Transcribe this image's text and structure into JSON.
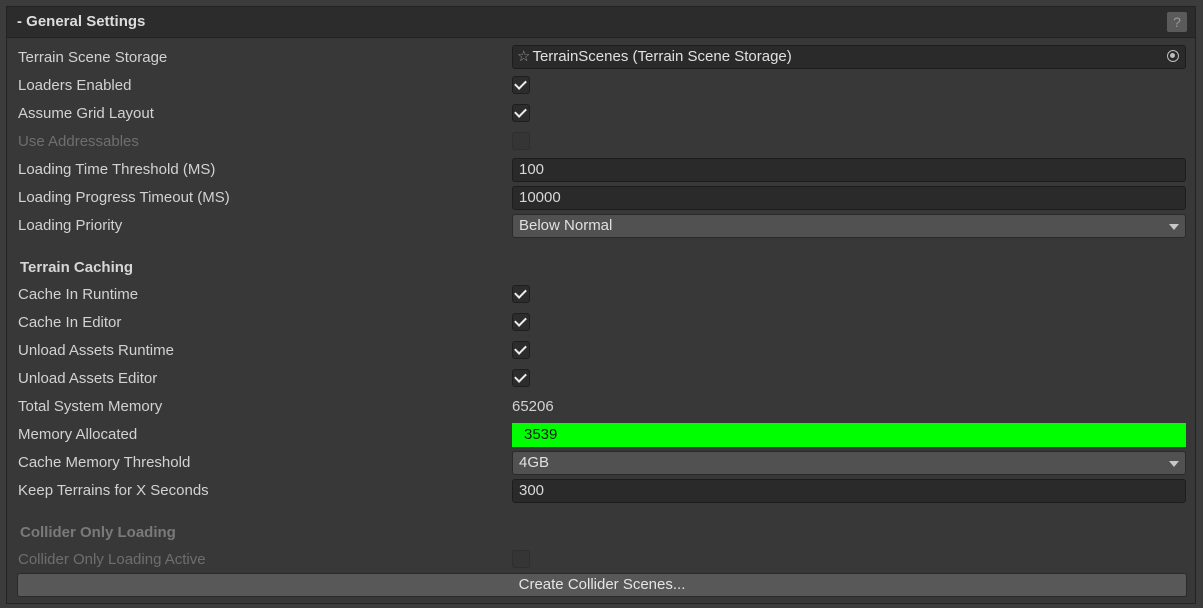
{
  "header": {
    "title": "- General Settings",
    "help_icon": "?"
  },
  "general": {
    "terrain_scene_storage": {
      "label": "Terrain Scene Storage",
      "value": "TerrainScenes (Terrain Scene Storage)"
    },
    "loaders_enabled": {
      "label": "Loaders Enabled",
      "checked": true
    },
    "assume_grid_layout": {
      "label": "Assume Grid Layout",
      "checked": true
    },
    "use_addressables": {
      "label": "Use Addressables",
      "checked": false,
      "disabled": true
    },
    "loading_time_threshold": {
      "label": "Loading Time Threshold (MS)",
      "value": "100"
    },
    "loading_progress_timeout": {
      "label": "Loading Progress Timeout (MS)",
      "value": "10000"
    },
    "loading_priority": {
      "label": "Loading Priority",
      "value": "Below Normal"
    }
  },
  "caching": {
    "section_title": "Terrain Caching",
    "cache_in_runtime": {
      "label": "Cache In Runtime",
      "checked": true
    },
    "cache_in_editor": {
      "label": "Cache In Editor",
      "checked": true
    },
    "unload_assets_runtime": {
      "label": "Unload Assets Runtime",
      "checked": true
    },
    "unload_assets_editor": {
      "label": "Unload Assets Editor",
      "checked": true
    },
    "total_system_memory": {
      "label": "Total System Memory",
      "value": "65206"
    },
    "memory_allocated": {
      "label": "Memory Allocated",
      "value": "3539",
      "bar_fill_percent": 100,
      "bar_color": "#00ff00"
    },
    "cache_memory_threshold": {
      "label": "Cache Memory Threshold",
      "value": "4GB"
    },
    "keep_terrains_seconds": {
      "label": "Keep Terrains for X Seconds",
      "value": "300"
    }
  },
  "collider": {
    "section_title": "Collider Only Loading",
    "collider_only_loading_active": {
      "label": "Collider Only Loading Active",
      "checked": false,
      "disabled": true
    },
    "create_button": "Create Collider Scenes..."
  }
}
